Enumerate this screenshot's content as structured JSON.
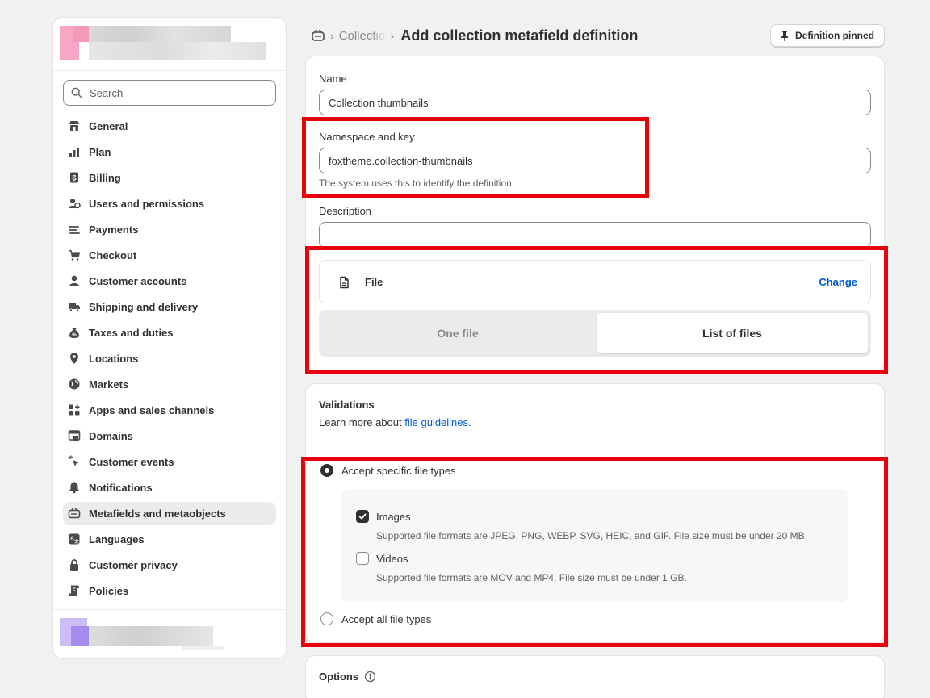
{
  "breadcrumb": {
    "parent": "Collections",
    "title": "Add collection metafield definition"
  },
  "header": {
    "pin_label": "Definition pinned"
  },
  "sidebar": {
    "search_placeholder": "Search",
    "items": [
      {
        "label": "General",
        "icon": "store-icon"
      },
      {
        "label": "Plan",
        "icon": "plan-icon"
      },
      {
        "label": "Billing",
        "icon": "billing-icon"
      },
      {
        "label": "Users and permissions",
        "icon": "users-icon"
      },
      {
        "label": "Payments",
        "icon": "payments-icon"
      },
      {
        "label": "Checkout",
        "icon": "cart-icon"
      },
      {
        "label": "Customer accounts",
        "icon": "person-icon"
      },
      {
        "label": "Shipping and delivery",
        "icon": "truck-icon"
      },
      {
        "label": "Taxes and duties",
        "icon": "tax-icon"
      },
      {
        "label": "Locations",
        "icon": "location-icon"
      },
      {
        "label": "Markets",
        "icon": "globe-icon"
      },
      {
        "label": "Apps and sales channels",
        "icon": "apps-icon"
      },
      {
        "label": "Domains",
        "icon": "domain-icon"
      },
      {
        "label": "Customer events",
        "icon": "cursor-icon"
      },
      {
        "label": "Notifications",
        "icon": "bell-icon"
      },
      {
        "label": "Metafields and metaobjects",
        "icon": "metafields-icon",
        "active": true
      },
      {
        "label": "Languages",
        "icon": "language-icon"
      },
      {
        "label": "Customer privacy",
        "icon": "lock-icon"
      },
      {
        "label": "Policies",
        "icon": "policy-icon"
      }
    ]
  },
  "form": {
    "name_label": "Name",
    "name_value": "Collection thumbnails",
    "ns_label": "Namespace and key",
    "ns_value": "foxtheme.collection-thumbnails",
    "ns_help": "The system uses this to identify the definition.",
    "desc_label": "Description",
    "desc_value": "",
    "type_name": "File",
    "change_label": "Change",
    "seg_one": "One file",
    "seg_list": "List of files",
    "seg_selected": "List of files"
  },
  "validations": {
    "title": "Validations",
    "learn_prefix": "Learn more about ",
    "learn_link": "file guidelines.",
    "radio_specific": "Accept specific file types",
    "radio_all": "Accept all file types",
    "selected": "Accept specific file types",
    "images_label": "Images",
    "images_checked": true,
    "images_help": "Supported file formats are JPEG, PNG, WEBP, SVG, HEIC, and GIF. File size must be under 20 MB.",
    "videos_label": "Videos",
    "videos_checked": false,
    "videos_help": "Supported file formats are MOV and MP4. File size must be under 1 GB."
  },
  "options": {
    "title": "Options"
  },
  "colors": {
    "highlight": "#e8000b",
    "link": "#005bd3"
  }
}
